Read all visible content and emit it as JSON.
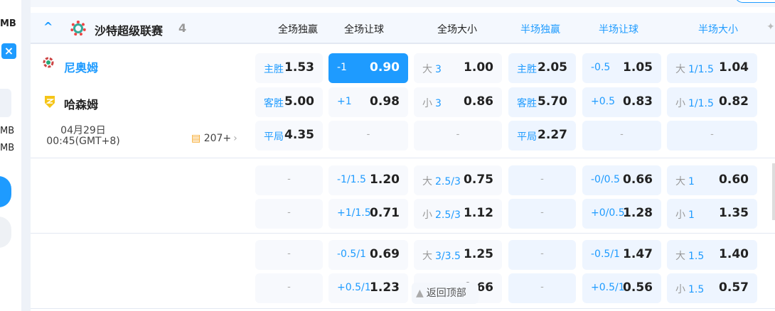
{
  "sidebar": {
    "texts": [
      "MB",
      "MB",
      "MB"
    ],
    "close_icon": "×"
  },
  "header": {
    "collapse_icon": "^",
    "league": "沙特超级联赛",
    "count": "4",
    "columns": [
      {
        "label": "全场独赢",
        "half": false
      },
      {
        "label": "全场让球",
        "half": false
      },
      {
        "label": "全场大小",
        "half": false
      },
      {
        "label": "半场独赢",
        "half": true
      },
      {
        "label": "半场让球",
        "half": true
      },
      {
        "label": "半场大小",
        "half": true
      }
    ],
    "pin_icon": "📌"
  },
  "match": {
    "home": "尼奥姆",
    "away": "哈森姆",
    "date": "04月29日",
    "time": "00:45(GMT+8)",
    "more_count": "207+",
    "home_color": "#1e9bff"
  },
  "dash": "-",
  "groups": [
    [
      [
        {
          "lab": "主胜",
          "odds": "1.53"
        },
        {
          "line": "-1",
          "odds": "0.90",
          "selected": true
        },
        {
          "g": "大",
          "line": "3",
          "odds": "1.00"
        },
        {
          "lab": "主胜",
          "odds": "2.05"
        },
        {
          "line": "-0.5",
          "odds": "1.05"
        },
        {
          "g": "大",
          "line": "1/1.5",
          "odds": "1.04"
        }
      ],
      [
        {
          "lab": "客胜",
          "odds": "5.00"
        },
        {
          "line": "+1",
          "odds": "0.98"
        },
        {
          "g": "小",
          "line": "3",
          "odds": "0.86"
        },
        {
          "lab": "客胜",
          "odds": "5.70"
        },
        {
          "line": "+0.5",
          "odds": "0.83"
        },
        {
          "g": "小",
          "line": "1/1.5",
          "odds": "0.82"
        }
      ],
      [
        {
          "lab": "平局",
          "odds": "4.35"
        },
        null,
        null,
        {
          "lab": "平局",
          "odds": "2.27"
        },
        null,
        null
      ]
    ],
    [
      [
        null,
        {
          "line": "-1/1.5",
          "odds": "1.20"
        },
        {
          "g": "大",
          "line": "2.5/3",
          "odds": "0.75"
        },
        null,
        {
          "line": "-0/0.5",
          "odds": "0.66"
        },
        {
          "g": "大",
          "line": "1",
          "odds": "0.60"
        }
      ],
      [
        null,
        {
          "line": "+1/1.5",
          "odds": "0.71"
        },
        {
          "g": "小",
          "line": "2.5/3",
          "odds": "1.12"
        },
        null,
        {
          "line": "+0/0.5",
          "odds": "1.28"
        },
        {
          "g": "小",
          "line": "1",
          "odds": "1.35"
        }
      ]
    ],
    [
      [
        null,
        {
          "line": "-0.5/1",
          "odds": "0.69"
        },
        {
          "g": "大",
          "line": "3/3.5",
          "odds": "1.25"
        },
        null,
        {
          "line": "-0.5/1",
          "odds": "1.47"
        },
        {
          "g": "大",
          "line": "1.5",
          "odds": "1.40"
        }
      ],
      [
        null,
        {
          "line": "+0.5/1",
          "odds": "1.23"
        },
        {
          "g": "小",
          "line": "3/3.5",
          "odds": "0.66"
        },
        null,
        {
          "line": "+0.5/1",
          "odds": "0.56"
        },
        {
          "g": "小",
          "line": "1.5",
          "odds": "0.57"
        }
      ]
    ]
  ],
  "back_to_top": "返回顶部",
  "colors": {
    "accent": "#1e9bff",
    "selected_bg": "#1e9bff",
    "half_bg": "#eef5ff",
    "full_bg": "#f7f9fd"
  }
}
